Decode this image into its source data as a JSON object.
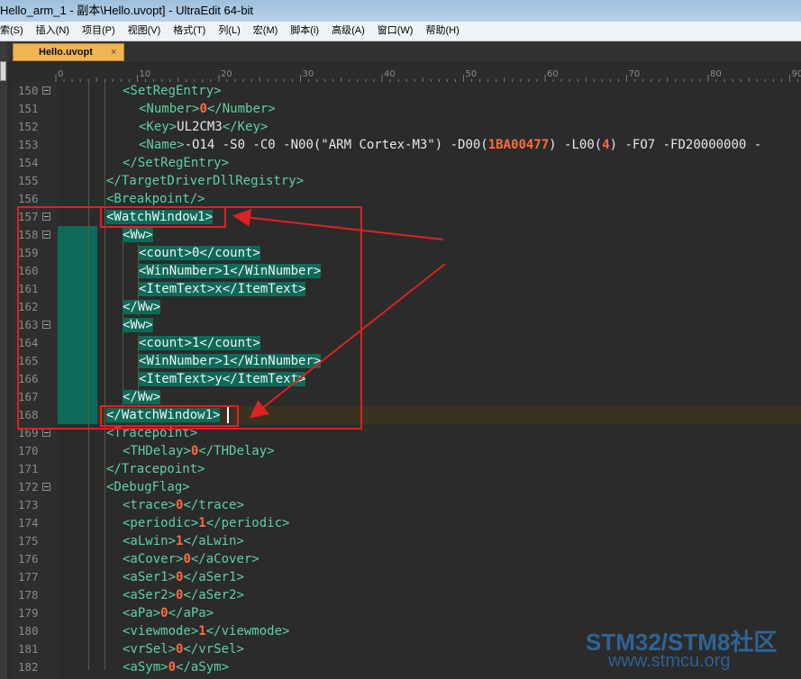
{
  "window": {
    "title": "Hello_arm_1 - 副本\\Hello.uvopt] - UltraEdit 64-bit"
  },
  "menu": [
    {
      "label": "索(S)"
    },
    {
      "label": "插入(N)"
    },
    {
      "label": "项目(P)"
    },
    {
      "label": "视图(V)"
    },
    {
      "label": "格式(T)"
    },
    {
      "label": "列(L)"
    },
    {
      "label": "宏(M)"
    },
    {
      "label": "脚本(i)"
    },
    {
      "label": "高级(A)"
    },
    {
      "label": "窗口(W)"
    },
    {
      "label": "帮助(H)"
    }
  ],
  "tab": {
    "label": "Hello.uvopt",
    "close_glyph": "×"
  },
  "ruler": {
    "ticks": [
      "0",
      "10",
      "20",
      "30",
      "40",
      "50",
      "60",
      "70",
      "80",
      "90"
    ]
  },
  "lines": [
    {
      "n": "150",
      "html": "<span class='t'>&lt;SetRegEntry&gt;</span>",
      "indent": 1
    },
    {
      "n": "151",
      "html": "<span class='t'>&lt;Number&gt;</span><span class='num'>0</span><span class='t'>&lt;/Number&gt;</span>",
      "indent": 2
    },
    {
      "n": "152",
      "html": "<span class='t'>&lt;Key&gt;</span><span class='txt'>UL2CM3</span><span class='t'>&lt;/Key&gt;</span>",
      "indent": 2
    },
    {
      "n": "153",
      "html": "<span class='t'>&lt;Name&gt;</span><span class='txt'>-O14 -S0 -C0 -N00(\"ARM Cortex-M3\") -D00(</span><span class='num'>1BA00477</span><span class='txt'>) -L00(</span><span class='num'>4</span><span class='txt'>) -FO7 -FD20000000 -</span>",
      "indent": 2
    },
    {
      "n": "154",
      "html": "<span class='t'>&lt;/SetRegEntry&gt;</span>",
      "indent": 1
    },
    {
      "n": "155",
      "html": "<span class='t'>&lt;/TargetDriverDllRegistry&gt;</span>",
      "indent": 0
    },
    {
      "n": "156",
      "html": "<span class='t'>&lt;Breakpoint/&gt;</span>",
      "indent": 0
    },
    {
      "n": "157",
      "html": "<span class='sel'>&lt;WatchWindow1&gt;</span>",
      "indent": 0
    },
    {
      "n": "158",
      "html": "<span class='sel'>&lt;Ww&gt;</span>",
      "indent": 1
    },
    {
      "n": "159",
      "html": "<span class='sel'>&lt;count&gt;0&lt;/count&gt;</span>",
      "indent": 2
    },
    {
      "n": "160",
      "html": "<span class='sel'>&lt;WinNumber&gt;1&lt;/WinNumber&gt;</span>",
      "indent": 2
    },
    {
      "n": "161",
      "html": "<span class='sel'>&lt;ItemText&gt;x&lt;/ItemText&gt;</span>",
      "indent": 2
    },
    {
      "n": "162",
      "html": "<span class='sel'>&lt;/Ww&gt;</span>",
      "indent": 1
    },
    {
      "n": "163",
      "html": "<span class='sel'>&lt;Ww&gt;</span>",
      "indent": 1
    },
    {
      "n": "164",
      "html": "<span class='sel'>&lt;count&gt;1&lt;/count&gt;</span>",
      "indent": 2
    },
    {
      "n": "165",
      "html": "<span class='sel'>&lt;WinNumber&gt;1&lt;/WinNumber&gt;</span>",
      "indent": 2
    },
    {
      "n": "166",
      "html": "<span class='sel'>&lt;ItemText&gt;y&lt;/ItemText&gt;</span>",
      "indent": 2
    },
    {
      "n": "167",
      "html": "<span class='sel'>&lt;/Ww&gt;</span>",
      "indent": 1
    },
    {
      "n": "168",
      "html": "<span class='sel'>&lt;/WatchWindow1&gt;</span>",
      "indent": 0
    },
    {
      "n": "169",
      "html": "<span class='t'>&lt;Tracepoint&gt;</span>",
      "indent": 0
    },
    {
      "n": "170",
      "html": "<span class='t'>&lt;THDelay&gt;</span><span class='num'>0</span><span class='t'>&lt;/THDelay&gt;</span>",
      "indent": 1
    },
    {
      "n": "171",
      "html": "<span class='t'>&lt;/Tracepoint&gt;</span>",
      "indent": 0
    },
    {
      "n": "172",
      "html": "<span class='t'>&lt;DebugFlag&gt;</span>",
      "indent": 0
    },
    {
      "n": "173",
      "html": "<span class='t'>&lt;trace&gt;</span><span class='num'>0</span><span class='t'>&lt;/trace&gt;</span>",
      "indent": 1
    },
    {
      "n": "174",
      "html": "<span class='t'>&lt;periodic&gt;</span><span class='num'>1</span><span class='t'>&lt;/periodic&gt;</span>",
      "indent": 1
    },
    {
      "n": "175",
      "html": "<span class='t'>&lt;aLwin&gt;</span><span class='num'>1</span><span class='t'>&lt;/aLwin&gt;</span>",
      "indent": 1
    },
    {
      "n": "176",
      "html": "<span class='t'>&lt;aCover&gt;</span><span class='num'>0</span><span class='t'>&lt;/aCover&gt;</span>",
      "indent": 1
    },
    {
      "n": "177",
      "html": "<span class='t'>&lt;aSer1&gt;</span><span class='num'>0</span><span class='t'>&lt;/aSer1&gt;</span>",
      "indent": 1
    },
    {
      "n": "178",
      "html": "<span class='t'>&lt;aSer2&gt;</span><span class='num'>0</span><span class='t'>&lt;/aSer2&gt;</span>",
      "indent": 1
    },
    {
      "n": "179",
      "html": "<span class='t'>&lt;aPa&gt;</span><span class='num'>0</span><span class='t'>&lt;/aPa&gt;</span>",
      "indent": 1
    },
    {
      "n": "180",
      "html": "<span class='t'>&lt;viewmode&gt;</span><span class='num'>1</span><span class='t'>&lt;/viewmode&gt;</span>",
      "indent": 1
    },
    {
      "n": "181",
      "html": "<span class='t'>&lt;vrSel&gt;</span><span class='num'>0</span><span class='t'>&lt;/vrSel&gt;</span>",
      "indent": 1
    },
    {
      "n": "182",
      "html": "<span class='t'>&lt;aSym&gt;</span><span class='num'>0</span><span class='t'>&lt;/aSym&gt;</span>",
      "indent": 1
    }
  ],
  "folds": [
    "150",
    "157",
    "158",
    "163",
    "169",
    "172"
  ],
  "watermark": {
    "line1": "STM32/STM8社区",
    "line2": "www.stmcu.org"
  },
  "colors": {
    "tag": "#5fd0a4",
    "number": "#ff6a3d",
    "selection": "#0e6a58",
    "annotation": "#e02020"
  }
}
